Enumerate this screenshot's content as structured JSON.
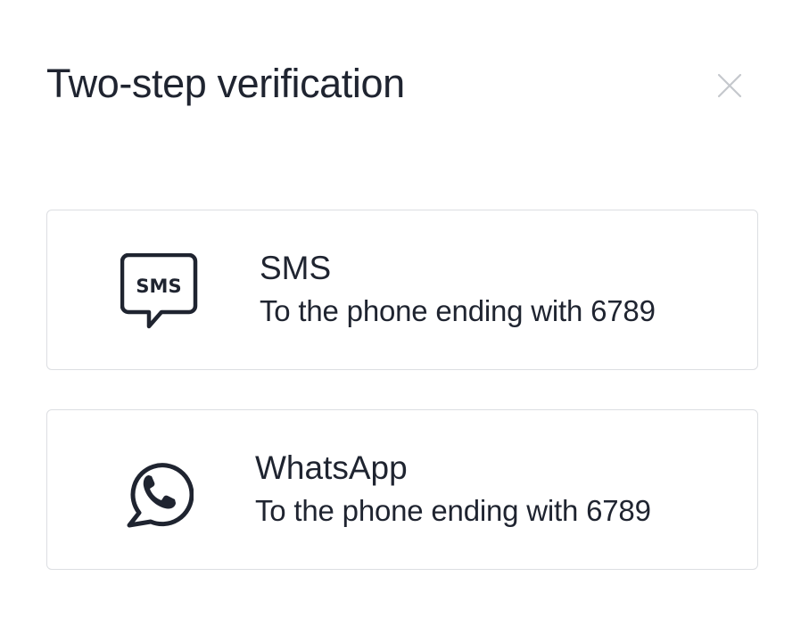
{
  "dialog": {
    "title": "Two-step verification",
    "close_icon": "close-icon"
  },
  "options": [
    {
      "id": "sms",
      "icon": "sms-chat-icon",
      "icon_text": "SMS",
      "title": "SMS",
      "subtitle": "To the phone ending with 6789"
    },
    {
      "id": "whatsapp",
      "icon": "whatsapp-icon",
      "title": "WhatsApp",
      "subtitle": "To the phone ending with 6789"
    }
  ],
  "colors": {
    "text": "#1f2430",
    "border": "#dcdee2",
    "close_icon": "#c5c8cd",
    "background": "#ffffff"
  }
}
